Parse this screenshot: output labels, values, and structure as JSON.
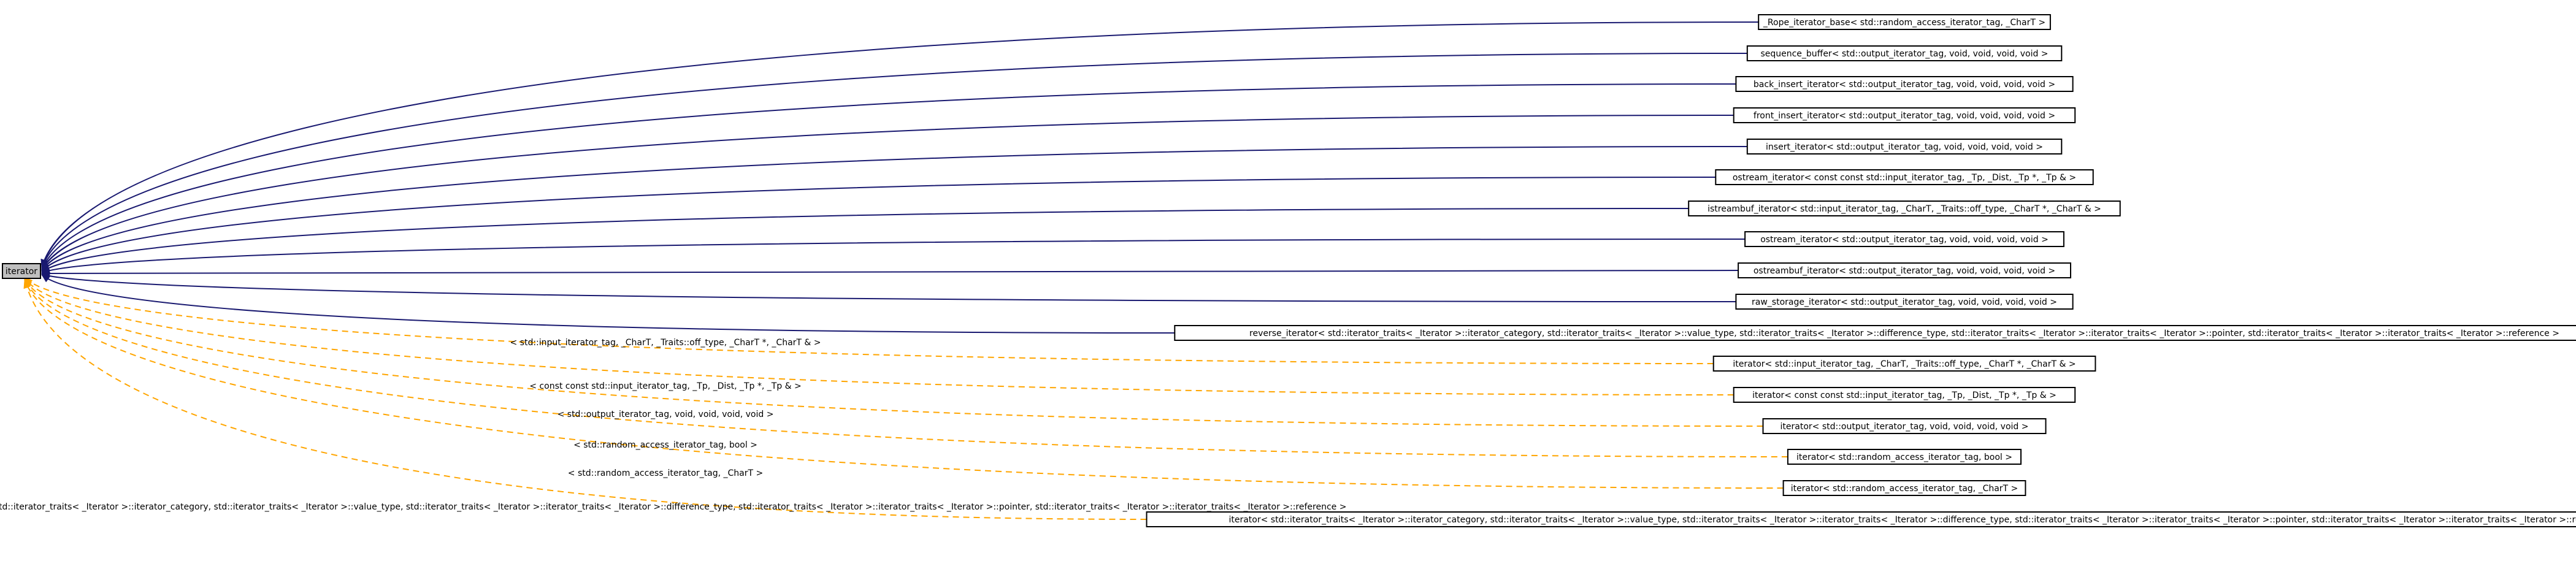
{
  "diagram": {
    "root": {
      "label": "iterator"
    },
    "derived": [
      {
        "label": "_Rope_iterator_base< std::random_access_iterator_tag, _CharT >",
        "border": "#ff0000"
      },
      {
        "label": "sequence_buffer< std::output_iterator_tag, void, void, void, void >",
        "border": "#000000"
      },
      {
        "label": "back_insert_iterator< std::output_iterator_tag, void, void, void, void >",
        "border": "#000000"
      },
      {
        "label": "front_insert_iterator< std::output_iterator_tag, void, void, void, void >",
        "border": "#000000"
      },
      {
        "label": "insert_iterator< std::output_iterator_tag, void, void, void, void >",
        "border": "#000000"
      },
      {
        "label": "ostream_iterator< const const std::input_iterator_tag, _Tp, _Dist, _Tp *, _Tp & >",
        "border": "#000000"
      },
      {
        "label": "istreambuf_iterator< std::input_iterator_tag, _CharT, _Traits::off_type, _CharT *, _CharT & >",
        "border": "#000000"
      },
      {
        "label": "ostream_iterator< std::output_iterator_tag, void, void, void, void >",
        "border": "#000000"
      },
      {
        "label": "ostreambuf_iterator< std::output_iterator_tag, void, void, void, void >",
        "border": "#000000"
      },
      {
        "label": "raw_storage_iterator< std::output_iterator_tag, void, void, void, void >",
        "border": "#000000"
      },
      {
        "label": "reverse_iterator< std::iterator_traits< _Iterator >::iterator_category, std::iterator_traits< _Iterator >::value_type, std::iterator_traits< _Iterator >::difference_type, std::iterator_traits< _Iterator >::iterator_traits< _Iterator >::pointer, std::iterator_traits< _Iterator >::iterator_traits< _Iterator >::reference >",
        "border": "#000000"
      }
    ],
    "instantiations": [
      {
        "label": "iterator< std::input_iterator_tag, _CharT, _Traits::off_type, _CharT *, _CharT & >",
        "edge_label": "< std::input_iterator_tag, _CharT, _Traits::off_type, _CharT *, _CharT & >",
        "border": "#000000"
      },
      {
        "label": "iterator< const const std::input_iterator_tag, _Tp, _Dist, _Tp *, _Tp & >",
        "edge_label": "< const const std::input_iterator_tag, _Tp, _Dist, _Tp *, _Tp & >",
        "border": "#000000"
      },
      {
        "label": "iterator< std::output_iterator_tag, void, void, void, void >",
        "edge_label": "< std::output_iterator_tag, void, void, void, void >",
        "border": "#000000"
      },
      {
        "label": "iterator< std::random_access_iterator_tag, bool >",
        "edge_label": "< std::random_access_iterator_tag, bool >",
        "border": "#ff0000"
      },
      {
        "label": "iterator< std::random_access_iterator_tag, _CharT >",
        "edge_label": "< std::random_access_iterator_tag, _CharT >",
        "border": "#000000"
      },
      {
        "label": "iterator< std::iterator_traits< _Iterator >::iterator_category, std::iterator_traits< _Iterator >::value_type, std::iterator_traits< _Iterator >::iterator_traits< _Iterator >::difference_type, std::iterator_traits< _Iterator >::iterator_traits< _Iterator >::pointer, std::iterator_traits< _Iterator >::iterator_traits< _Iterator >::reference >",
        "edge_label": "< std::iterator_traits< _Iterator >::iterator_category, std::iterator_traits< _Iterator >::value_type, std::iterator_traits< _Iterator >::iterator_traits< _Iterator >::difference_type, std::iterator_traits< _Iterator >::iterator_traits< _Iterator >::pointer, std::iterator_traits< _Iterator >::iterator_traits< _Iterator >::reference >",
        "border": "#000000"
      }
    ]
  }
}
